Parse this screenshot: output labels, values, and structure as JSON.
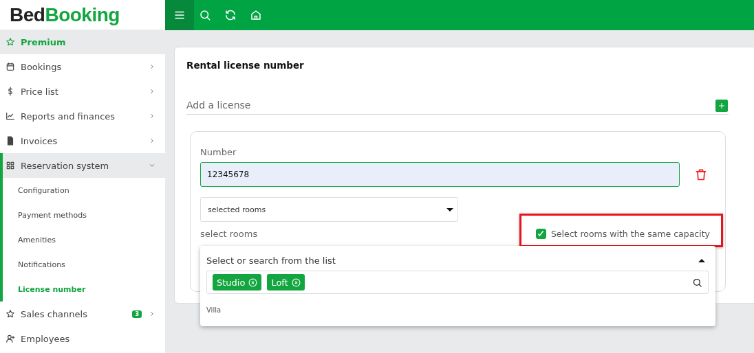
{
  "logo": {
    "first": "Bed",
    "second": "Booking"
  },
  "sidebar": {
    "items": [
      {
        "label": "Premium",
        "selected": true
      },
      {
        "label": "Bookings",
        "selected": false,
        "expanded": false
      },
      {
        "label": "Price list",
        "selected": false,
        "expanded": false
      },
      {
        "label": "Reports and finances",
        "selected": false,
        "expanded": false
      },
      {
        "label": "Invoices",
        "selected": false,
        "expanded": false
      },
      {
        "label": "Reservation system",
        "selected": false,
        "expanded": true,
        "children": [
          {
            "label": "Configuration",
            "selected": false
          },
          {
            "label": "Payment methods",
            "selected": false
          },
          {
            "label": "Amenities",
            "selected": false
          },
          {
            "label": "Notifications",
            "selected": false
          },
          {
            "label": "License number",
            "selected": true
          }
        ]
      },
      {
        "label": "Sales channels",
        "selected": false,
        "expanded": false,
        "badge": "3"
      },
      {
        "label": "Employees",
        "selected": false
      }
    ]
  },
  "card": {
    "title": "Rental license number",
    "section": "Add a license",
    "license": {
      "number_label": "Number",
      "number_value": "12345678",
      "scope_select": "selected rooms",
      "rooms_label": "select rooms",
      "same_capacity": {
        "label": "Select rooms with the same capacity",
        "checked": true,
        "highlighted": true
      },
      "dropdown": {
        "title": "Select or search from the list",
        "expanded": true,
        "tags": [
          "Studio",
          "Loft"
        ],
        "options": [
          "Villa"
        ]
      }
    }
  }
}
